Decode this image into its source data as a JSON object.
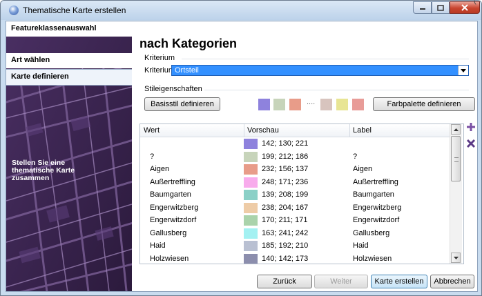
{
  "window": {
    "title": "Thematische Karte erstellen",
    "bracket_glyph": "("
  },
  "sidebar": {
    "items": [
      {
        "label": "Featureklassenauswahl"
      },
      {
        "label": "Art wählen"
      },
      {
        "label": "Karte definieren",
        "selected": true
      }
    ],
    "hint": "Stellen Sie eine thematische Karte zusammen"
  },
  "main": {
    "heading": "nach Kategorien",
    "kriterium_group": "Kriterium",
    "kriterium_label": "Kriterium:",
    "kriterium_value": "Ortsteil",
    "stil_group": "Stileigenschaften",
    "basisstil_button": "Basisstil definieren",
    "palette_dots": "....",
    "farbpalette_button": "Farbpalette definieren",
    "palette_colors": [
      "#8e82dd",
      "#c7d4ba",
      "#e89c89",
      "#d8c4be",
      "#e8e594",
      "#e89c98"
    ]
  },
  "table": {
    "columns": [
      "Wert",
      "Vorschau",
      "Label"
    ],
    "rows": [
      {
        "wert": "",
        "vorschau": "142; 130; 221",
        "color": "#8e82dd",
        "label": ""
      },
      {
        "wert": "?",
        "vorschau": "199; 212; 186",
        "color": "#c7d4ba",
        "label": "?"
      },
      {
        "wert": "Aigen",
        "vorschau": "232; 156; 137",
        "color": "#e89c89",
        "label": "Aigen"
      },
      {
        "wert": "Außertreffling",
        "vorschau": "248; 171; 236",
        "color": "#f8abec",
        "label": "Außertreffling"
      },
      {
        "wert": "Baumgarten",
        "vorschau": "139; 208; 199",
        "color": "#8bd0c7",
        "label": "Baumgarten"
      },
      {
        "wert": "Engerwitzberg",
        "vorschau": "238; 204; 167",
        "color": "#eecca7",
        "label": "Engerwitzberg"
      },
      {
        "wert": "Engerwitzdorf",
        "vorschau": "170; 211; 171",
        "color": "#aad3ab",
        "label": "Engerwitzdorf"
      },
      {
        "wert": "Gallusberg",
        "vorschau": "163; 241; 242",
        "color": "#a3f1f2",
        "label": "Gallusberg"
      },
      {
        "wert": "Haid",
        "vorschau": "185; 192; 210",
        "color": "#b9c0d2",
        "label": "Haid"
      },
      {
        "wert": "Holzwiesen",
        "vorschau": "140; 142; 173",
        "color": "#8c8ead",
        "label": "Holzwiesen"
      }
    ]
  },
  "footer": {
    "back": "Zurück",
    "next": "Weiter",
    "create": "Karte erstellen",
    "cancel": "Abbrechen"
  },
  "colors": {
    "add": "#7a4fa3",
    "remove": "#5b3a86",
    "sidebar_bg": "#3e2652"
  },
  "icons": {
    "add": "plus-icon",
    "remove": "cross-icon"
  }
}
